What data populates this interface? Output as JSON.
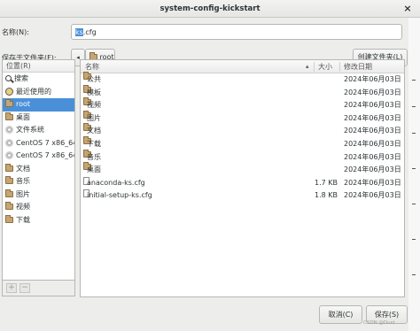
{
  "window": {
    "title": "system-config-kickstart",
    "close_glyph": "×"
  },
  "name_row": {
    "label": "名称(N):",
    "value_selected": "ks",
    "value_rest": ".cfg"
  },
  "save_in_row": {
    "label": "保存于文件夹(F):",
    "back_glyph": "◂",
    "path_button": "root",
    "create_folder_button": "创建文件夹(L)"
  },
  "places": {
    "header": "位置(R)",
    "items": [
      {
        "label": "搜索",
        "icon": "search-icon"
      },
      {
        "label": "最近使用的",
        "icon": "recent-icon"
      },
      {
        "label": "root",
        "icon": "folder-icon",
        "selected": true
      },
      {
        "label": "桌面",
        "icon": "folder-icon"
      },
      {
        "label": "文件系统",
        "icon": "disk-icon"
      },
      {
        "label": "CentOS 7 x86_64",
        "icon": "disk-icon"
      },
      {
        "label": "CentOS 7 x86_64",
        "icon": "disk-icon"
      },
      {
        "label": "文档",
        "icon": "folder-icon"
      },
      {
        "label": "音乐",
        "icon": "folder-icon"
      },
      {
        "label": "图片",
        "icon": "folder-icon"
      },
      {
        "label": "视频",
        "icon": "folder-icon"
      },
      {
        "label": "下载",
        "icon": "folder-icon"
      }
    ],
    "add_glyph": "+",
    "remove_glyph": "−"
  },
  "files": {
    "columns": {
      "name": "名称",
      "sort_glyph": "▴",
      "size": "大小",
      "modified": "修改日期"
    },
    "rows": [
      {
        "name": "公共",
        "size": "",
        "modified": "2024年06月03日",
        "type": "folder"
      },
      {
        "name": "模板",
        "size": "",
        "modified": "2024年06月03日",
        "type": "folder"
      },
      {
        "name": "视频",
        "size": "",
        "modified": "2024年06月03日",
        "type": "folder"
      },
      {
        "name": "图片",
        "size": "",
        "modified": "2024年06月03日",
        "type": "folder"
      },
      {
        "name": "文档",
        "size": "",
        "modified": "2024年06月03日",
        "type": "folder"
      },
      {
        "name": "下载",
        "size": "",
        "modified": "2024年06月03日",
        "type": "folder"
      },
      {
        "name": "音乐",
        "size": "",
        "modified": "2024年06月03日",
        "type": "folder"
      },
      {
        "name": "桌面",
        "size": "",
        "modified": "2024年06月03日",
        "type": "folder"
      },
      {
        "name": "anaconda-ks.cfg",
        "size": "1.7 KB",
        "modified": "2024年06月03日",
        "type": "file"
      },
      {
        "name": "initial-setup-ks.cfg",
        "size": "1.8 KB",
        "modified": "2024年06月03日",
        "type": "file"
      }
    ]
  },
  "buttons": {
    "cancel": "取消(C)",
    "save": "保存(S)"
  },
  "watermark": "CSDN @Dust"
}
